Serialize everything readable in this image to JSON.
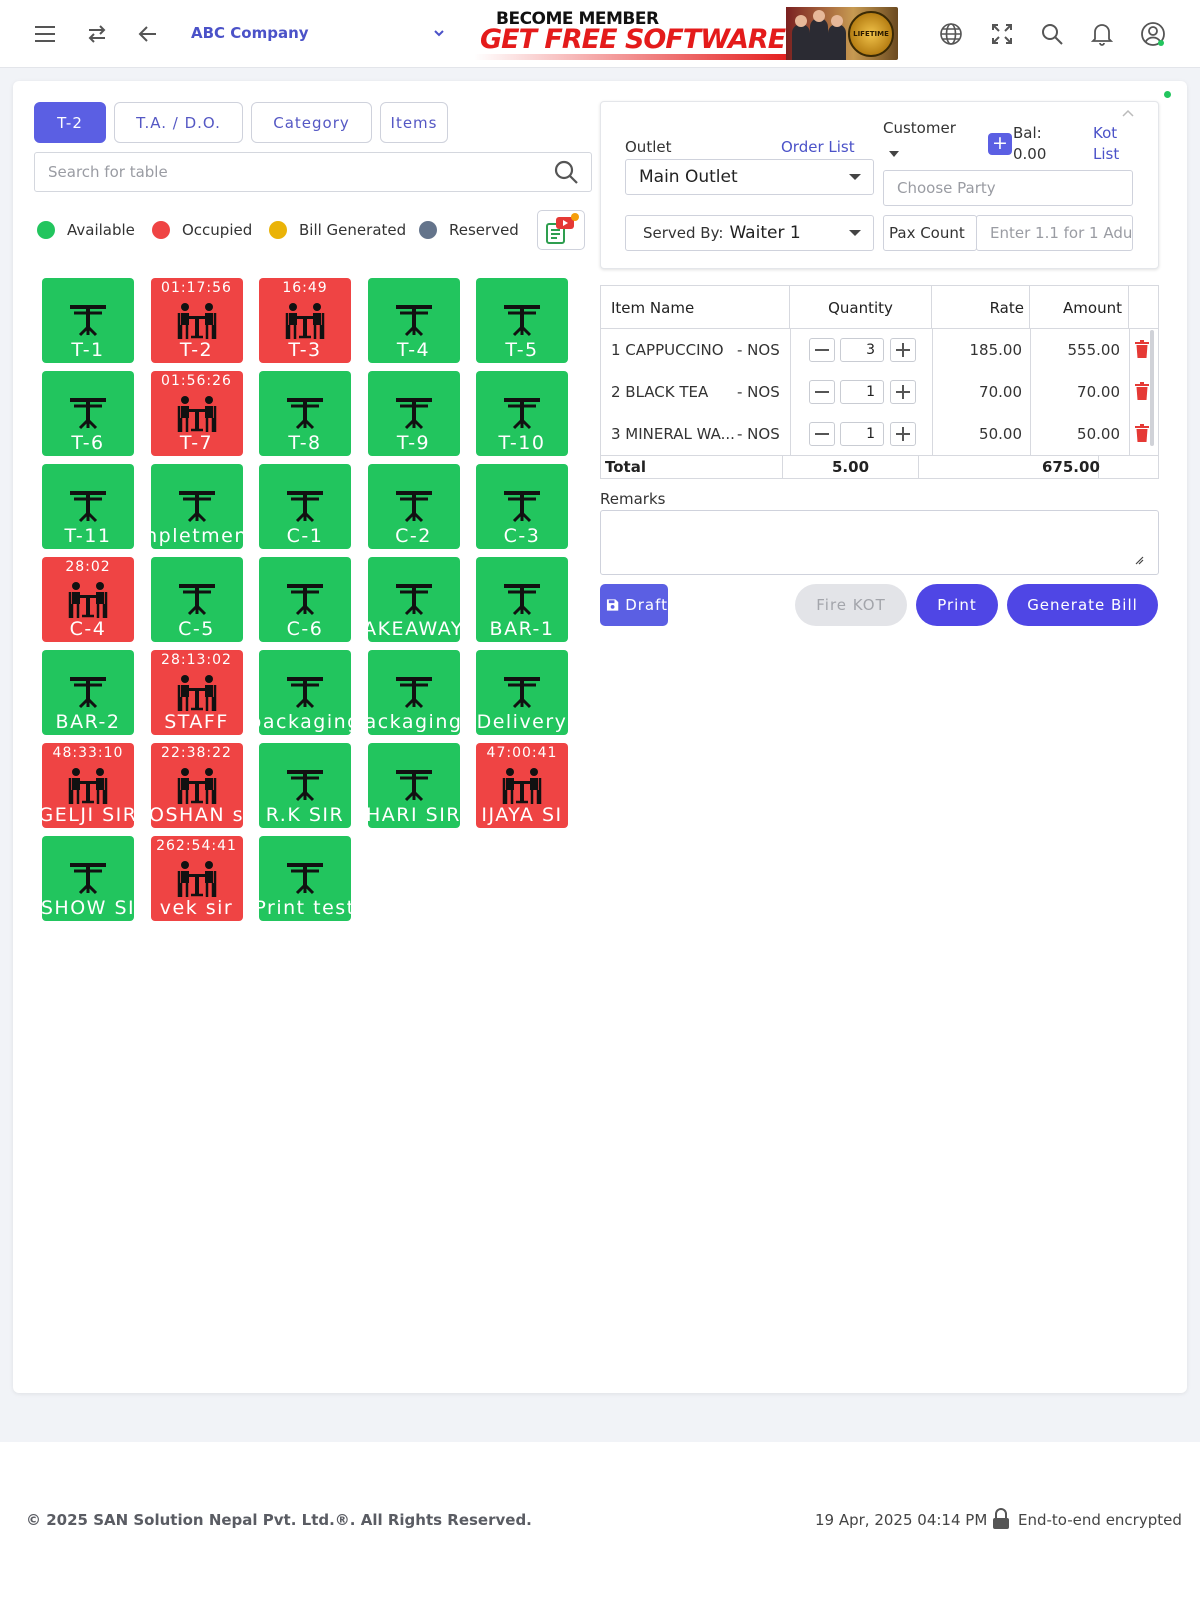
{
  "header": {
    "company": "ABC Company",
    "banner_line1": "BECOME MEMBER",
    "banner_line2": "GET FREE SOFTWARE",
    "banner_badge": "LIFETIME"
  },
  "tabs": [
    {
      "label": "T-2",
      "active": true
    },
    {
      "label": "T.A. / D.O.",
      "active": false
    },
    {
      "label": "Category",
      "active": false
    },
    {
      "label": "Items",
      "active": false
    }
  ],
  "search": {
    "placeholder": "Search for table"
  },
  "legend": [
    {
      "label": "Available",
      "color": "#22c55e"
    },
    {
      "label": "Occupied",
      "color": "#ef4444"
    },
    {
      "label": "Bill Generated",
      "color": "#eab308"
    },
    {
      "label": "Reserved",
      "color": "#64748b"
    }
  ],
  "tables": [
    {
      "name": "T-1",
      "status": "available",
      "timer": ""
    },
    {
      "name": "T-2",
      "status": "occupied",
      "timer": "01:17:56"
    },
    {
      "name": "T-3",
      "status": "occupied",
      "timer": "16:49"
    },
    {
      "name": "T-4",
      "status": "available",
      "timer": ""
    },
    {
      "name": "T-5",
      "status": "available",
      "timer": ""
    },
    {
      "name": "T-6",
      "status": "available",
      "timer": ""
    },
    {
      "name": "T-7",
      "status": "occupied",
      "timer": "01:56:26"
    },
    {
      "name": "T-8",
      "status": "available",
      "timer": ""
    },
    {
      "name": "T-9",
      "status": "available",
      "timer": ""
    },
    {
      "name": "T-10",
      "status": "available",
      "timer": ""
    },
    {
      "name": "T-11",
      "status": "available",
      "timer": ""
    },
    {
      "name": "npletmen",
      "status": "available",
      "timer": ""
    },
    {
      "name": "C-1",
      "status": "available",
      "timer": ""
    },
    {
      "name": "C-2",
      "status": "available",
      "timer": ""
    },
    {
      "name": "C-3",
      "status": "available",
      "timer": ""
    },
    {
      "name": "C-4",
      "status": "occupied",
      "timer": "28:02"
    },
    {
      "name": "C-5",
      "status": "available",
      "timer": ""
    },
    {
      "name": "C-6",
      "status": "available",
      "timer": ""
    },
    {
      "name": "AKEAWAY",
      "status": "available",
      "timer": ""
    },
    {
      "name": "BAR-1",
      "status": "available",
      "timer": ""
    },
    {
      "name": "BAR-2",
      "status": "available",
      "timer": ""
    },
    {
      "name": "STAFF",
      "status": "occupied",
      "timer": "28:13:02"
    },
    {
      "name": "packaging",
      "status": "available",
      "timer": ""
    },
    {
      "name": "ackaging",
      "status": "available",
      "timer": ""
    },
    {
      "name": "Delivery",
      "status": "available",
      "timer": ""
    },
    {
      "name": "GELJI SIR",
      "status": "occupied",
      "timer": "48:33:10"
    },
    {
      "name": "OSHAN s",
      "status": "occupied",
      "timer": "22:38:22"
    },
    {
      "name": "R.K SIR",
      "status": "available",
      "timer": ""
    },
    {
      "name": "HARI SIR",
      "status": "available",
      "timer": ""
    },
    {
      "name": "IJAYA SI",
      "status": "occupied",
      "timer": "47:00:41"
    },
    {
      "name": "SHOW SI",
      "status": "available",
      "timer": ""
    },
    {
      "name": "vek sir",
      "status": "occupied",
      "timer": "262:54:41"
    },
    {
      "name": "Print test",
      "status": "available",
      "timer": ""
    }
  ],
  "order": {
    "outlet_label": "Outlet",
    "order_list_link": "Order List",
    "customer_label": "Customer",
    "bal_label": "Bal:",
    "bal_value": "0.00",
    "kot_list_link_1": "Kot",
    "kot_list_link_2": "List",
    "outlet_value": "Main Outlet",
    "party_placeholder": "Choose Party",
    "served_by_label": "Served By:",
    "served_by_value": "Waiter 1",
    "pax_label": "Pax Count",
    "pax_placeholder": "Enter 1.1 for 1 Adu"
  },
  "items_table": {
    "headers": {
      "name": "Item Name",
      "qty": "Quantity",
      "rate": "Rate",
      "amount": "Amount"
    },
    "rows": [
      {
        "name": "1 CAPPUCCINO",
        "unit": "-  NOS",
        "qty": "3",
        "rate": "185.00",
        "amount": "555.00"
      },
      {
        "name": "2 BLACK TEA",
        "unit": "-  NOS",
        "qty": "1",
        "rate": "70.00",
        "amount": "70.00"
      },
      {
        "name": "3 MINERAL WA...",
        "unit": "-  NOS",
        "qty": "1",
        "rate": "50.00",
        "amount": "50.00"
      }
    ],
    "total_label": "Total",
    "total_qty": "5.00",
    "total_amount": "675.00"
  },
  "remarks": {
    "label": "Remarks",
    "value": ""
  },
  "buttons": {
    "draft": "Draft",
    "fire_kot": "Fire KOT",
    "print": "Print",
    "generate_bill": "Generate Bill"
  },
  "footer": {
    "copyright": "© 2025   SAN Solution Nepal Pvt. Ltd.®. All Rights Reserved.",
    "datetime": "19 Apr, 2025 04:14 PM",
    "encrypted": "End-to-end encrypted"
  }
}
